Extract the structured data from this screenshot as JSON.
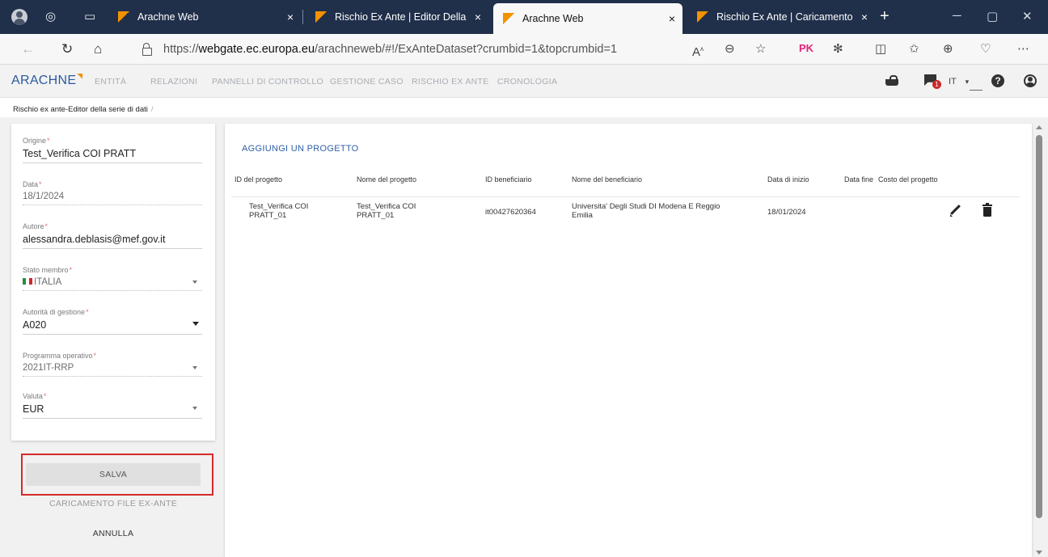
{
  "browser": {
    "tabs": [
      {
        "title": "Arachne Web",
        "active": false
      },
      {
        "title": "Rischio Ex Ante | Editor Della Se",
        "active": false
      },
      {
        "title": "Arachne Web",
        "active": true
      },
      {
        "title": "Rischio Ex Ante | Caricamento F",
        "active": false
      }
    ],
    "close_glyph": "×",
    "new_tab_glyph": "+",
    "url_prefix": "https://",
    "url_host": "webgate.ec.europa.eu",
    "url_path": "/arachneweb/#!/ExAnteDataset?crumbid=1&topcrumbid=1",
    "profile_badge": "PK",
    "icons": [
      "back-icon",
      "refresh-icon",
      "home-icon",
      "lock-icon",
      "read-aloud-icon",
      "zoom-icon",
      "favorite-star-icon",
      "extensions-icon",
      "split-screen-icon",
      "favorites-icon",
      "collections-icon",
      "health-icon",
      "more-icon"
    ]
  },
  "app": {
    "logo": "ARACHNE",
    "menu": [
      "ENTITÀ",
      "RELAZIONI",
      "PANNELLI DI CONTROLLO",
      "GESTIONE CASO",
      "RISCHIO EX ANTE",
      "CRONOLOGIA"
    ],
    "language": "IT",
    "notification_count": "1",
    "help_glyph": "?"
  },
  "breadcrumb": {
    "current": "Rischio ex ante-Editor della serie di dati",
    "separator": "/"
  },
  "form": {
    "origin_label": "Origine",
    "origin_value": "Test_Verifica COI PRATT",
    "date_label": "Data",
    "date_value": "18/1/2024",
    "author_label": "Autore",
    "author_value": "alessandra.deblasis@mef.gov.it",
    "member_state_label": "Stato membro",
    "member_state_value": "ITALIA",
    "managing_authority_label": "Autorità di gestione",
    "managing_authority_value": "A020",
    "program_label": "Programma operativo",
    "program_value": "2021IT-RRP",
    "currency_label": "Valuta",
    "currency_value": "EUR",
    "required_mark": "*"
  },
  "actions": {
    "save": "SALVA",
    "upload": "CARICAMENTO FILE EX-ANTE",
    "cancel": "ANNULLA"
  },
  "projects": {
    "add_label": "AGGIUNGI UN PROGETTO",
    "columns": [
      "ID del progetto",
      "Nome del progetto",
      "ID beneficiario",
      "Nome del beneficiario",
      "Data di inizio",
      "Data fine",
      "Costo del progetto"
    ],
    "rows": [
      {
        "project_id": "Test_Verifica COI PRATT_01",
        "project_name": "Test_Verifica COI PRATT_01",
        "beneficiary_id": "it00427620364",
        "beneficiary_name": "Universita' Degli Studi DI Modena E Reggio Emilia",
        "start_date": "18/01/2024",
        "end_date": "",
        "cost": ""
      }
    ]
  },
  "colors": {
    "accent": "#2d5fa6",
    "logo_tick": "#f39200",
    "highlight_frame": "#d42a2a",
    "tabbar": "#202f4a"
  }
}
